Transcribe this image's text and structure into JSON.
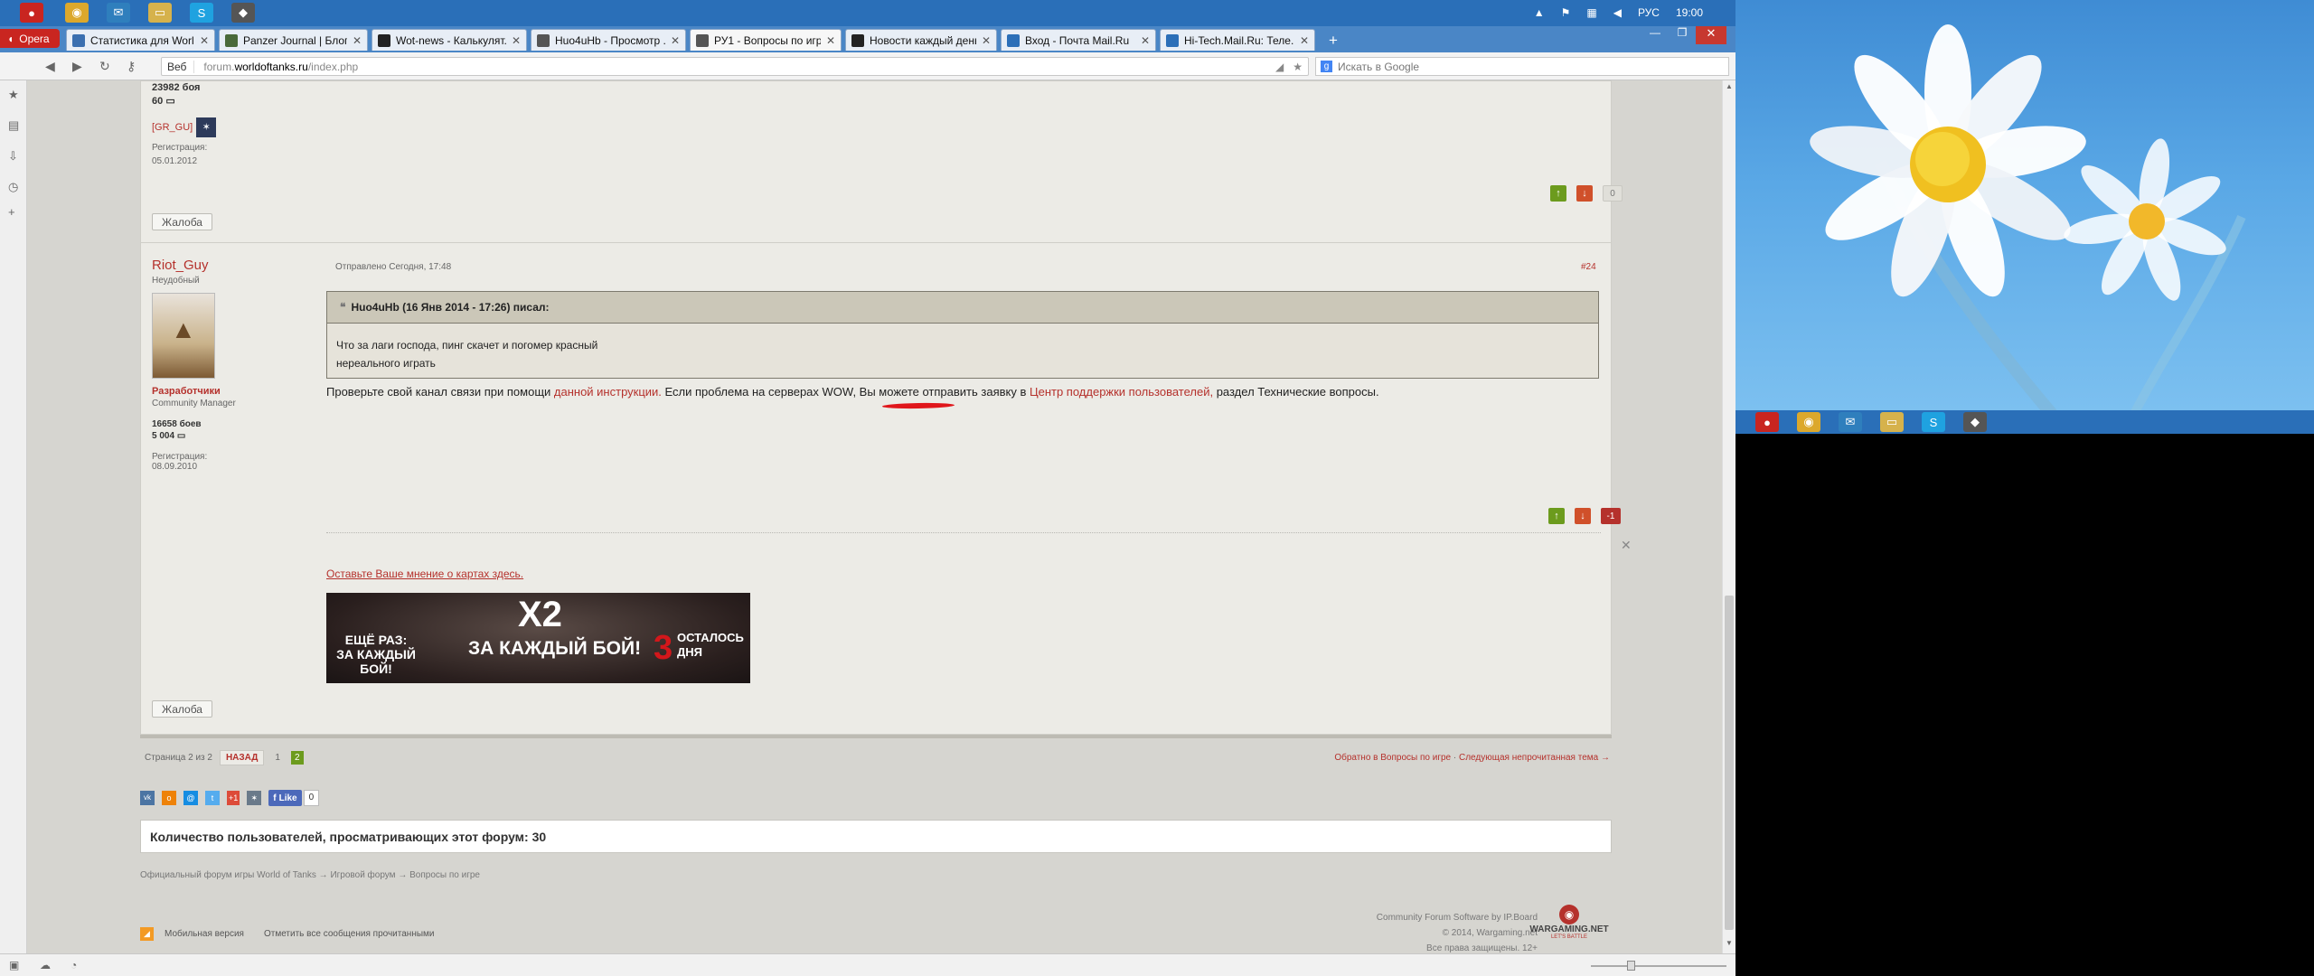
{
  "taskbar": {
    "icons": [
      "opera-icon",
      "chrome-icon",
      "mail-icon",
      "folder-icon",
      "skype-icon",
      "wot-icon"
    ],
    "tray": {
      "language": "РУС",
      "time": "19:00"
    }
  },
  "browser": {
    "menu_label": "Opera",
    "tabs": [
      {
        "label": "Статистика для World ...",
        "icon": "world-icon",
        "color": "#3a6fb0"
      },
      {
        "label": "Panzer Journal | Блог о...",
        "icon": "panzer-icon",
        "color": "#4a6a3a"
      },
      {
        "label": "Wot-news - Калькулят...",
        "icon": "w-icon",
        "color": "#222222"
      },
      {
        "label": "Huo4uHb - Просмотр ...",
        "icon": "shield-icon",
        "color": "#555555"
      },
      {
        "label": "РУ1 - Вопросы по игр...",
        "icon": "shield-icon",
        "color": "#555555",
        "active": true
      },
      {
        "label": "Новости каждый день",
        "icon": "w-icon",
        "color": "#222222"
      },
      {
        "label": "Вход - Почта Mail.Ru",
        "icon": "mail-icon",
        "color": "#2c6fb8"
      },
      {
        "label": "Hi-Tech.Mail.Ru: Теле...",
        "icon": "hitech-icon",
        "color": "#2c6fb8"
      }
    ],
    "address": {
      "scheme_label": "Веб",
      "url_prefix": "forum.",
      "url_domain": "worldoftanks.ru",
      "url_path": "/index.php"
    },
    "search_placeholder": "Искать в Google"
  },
  "prev_post": {
    "battles": "23982 боя",
    "posts": "60",
    "clan": "[GR_GU]",
    "reg_label": "Регистрация:",
    "reg_date": "05.01.2012",
    "rep_value": "0",
    "report_label": "Жалоба"
  },
  "post": {
    "author": "Riot_Guy",
    "author_status": "Неудобный",
    "group": "Разработчики",
    "title": "Community Manager",
    "battles": "16658 боев",
    "posts": "5 004",
    "reg_label": "Регистрация:",
    "reg_date": "08.09.2010",
    "sent": "Отправлено Сегодня, 17:48",
    "number": "#24",
    "quote_author": "Huo4uHb (16 Янв 2014 - 17:26) писал:",
    "quote_lines": [
      "Что за лаги господа, пинг скачет и погомер красный",
      "нереального играть"
    ],
    "body_before": "Проверьте свой канал связи при помощи ",
    "link1": "данной инструкции.",
    "body_mid": " Если проблема на серверах WOW, Вы можете отправить заявку в ",
    "link2": "Центр поддержки пользователей,",
    "body_after": " раздел Технические вопросы.",
    "rep_value": "-1",
    "sig_link": "Оставьте Ваше мнение о картах здесь.",
    "banner": {
      "top": "X2",
      "middle": "ЗА КАЖДЫЙ БОЙ!",
      "left": "ЕЩЁ РАЗ: ЗА КАЖДЫЙ БОЙ!",
      "days_num": "3",
      "days_text": "ОСТАЛОСЬ ДНЯ"
    },
    "report_label": "Жалоба"
  },
  "pagination": {
    "info": "Страница 2 из 2",
    "back": "НАЗАД",
    "pages": [
      "1",
      "2"
    ],
    "current": "2",
    "back_to_forum": "Обратно в Вопросы по игре",
    "next_topic": "Следующая непрочитанная тема →"
  },
  "share": {
    "like_label": "Like",
    "like_count": "0",
    "gplus": "+1"
  },
  "viewers": "Количество пользователей, просматривающих этот форум: 30",
  "breadcrumbs": [
    "Официальный форум игры World of Tanks",
    "Игровой форум",
    "Вопросы по игре"
  ],
  "bottom_links": [
    "Мобильная версия",
    "Отметить все сообщения прочитанными"
  ],
  "copyright": [
    "Community Forum Software by IP.Board",
    "© 2014, Wargaming.net",
    "Все права защищены. 12+"
  ],
  "wg_logo": {
    "name": "WARGAMING.NET",
    "slogan": "LET'S BATTLE"
  },
  "colors": {
    "accent_red": "#b5312c",
    "vote_up": "#6c9b1d",
    "vote_down": "#d0502a",
    "page_active": "#6c9b1d"
  }
}
